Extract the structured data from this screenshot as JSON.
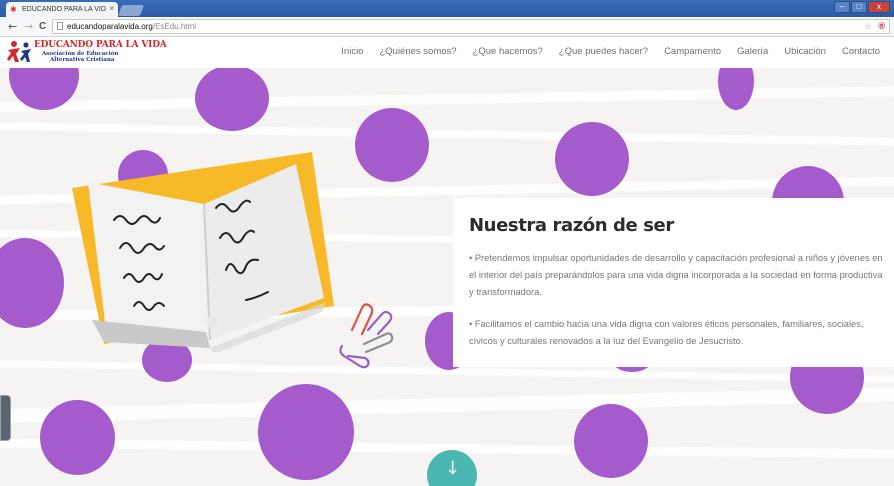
{
  "browser": {
    "tab_title": "EDUCANDO PARA LA VID",
    "tab_close": "×",
    "url_domain": "educandoparalavida.org",
    "url_path": "/EsEdu.html",
    "nav": {
      "back": "←",
      "forward": "→",
      "reload": "C"
    },
    "star": "☆",
    "pinterest": "®",
    "win_min": "–",
    "win_max": "□",
    "win_close": "x"
  },
  "site": {
    "logo": {
      "line1": "EDUCANDO PARA LA VIDA",
      "line2": "Asociación de Educación",
      "line3": "Alternativa Cristiana"
    },
    "nav_items": [
      "Inicio",
      "¿Quiénes somos?",
      "¿Que hacemos?",
      "¿Que puedes hacer?",
      "Campamento",
      "Galería",
      "Ubicación",
      "Contacto"
    ]
  },
  "hero": {
    "heading": "Nuestra razón de ser",
    "paragraph1": "• Pretendemos impulsar oportunidades de desarrollo y capacitación profesional a niños y jóvenes en el interior del país preparándolos para una vida digna incorporada a la sociedad en forma productiva y transformadora.",
    "paragraph2": "• Facilitamos el cambio hacia una vida digna con valores éticos personales, familiares, sociales, cívicos y culturales renovados a la luz del Evangelio de Jesucristo.",
    "scroll_down_icon": "arrow-down-icon"
  },
  "colors": {
    "accent_purple": "#a65bcc",
    "teal_button": "#4cb6b0",
    "book_cover": "#f7b927",
    "logo_red": "#d1282e",
    "logo_blue": "#1b3a8f"
  }
}
